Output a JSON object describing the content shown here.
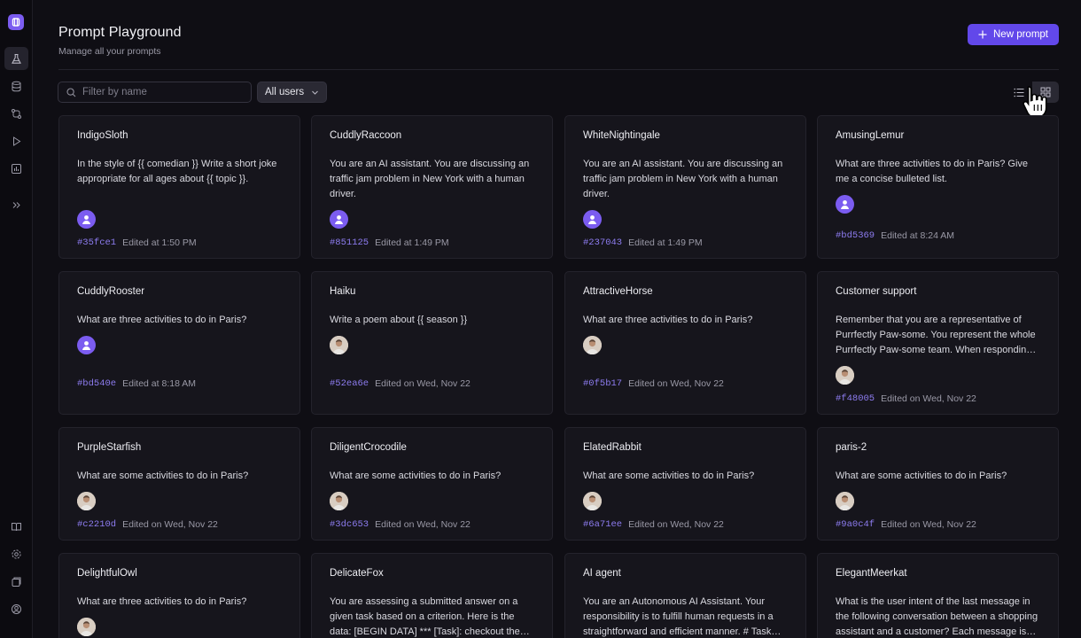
{
  "header": {
    "title": "Prompt Playground",
    "subtitle": "Manage all your prompts",
    "new_button_label": "New prompt"
  },
  "toolbar": {
    "search_placeholder": "Filter by name",
    "users_filter": "All users",
    "view_modes": [
      "list",
      "grid"
    ],
    "active_view": "grid"
  },
  "sidebar": {
    "items": [
      "playground-flask",
      "datasets",
      "experiments",
      "run",
      "monitor",
      "expand"
    ],
    "bottom_items": [
      "docs",
      "settings",
      "help",
      "account"
    ]
  },
  "colors": {
    "accent": "#6248ea",
    "hash": "#8d7cf0",
    "background": "#0f0e14",
    "card": "#16151c"
  },
  "cards": [
    {
      "name": "IndigoSloth",
      "text": "In the style of {{ comedian }} Write a short joke appropriate for all ages about {{ topic }}.",
      "avatar": "purple",
      "hash": "#35fce1",
      "edited": "Edited at 1:50 PM"
    },
    {
      "name": "CuddlyRaccoon",
      "text": "You are an AI assistant. You are discussing an traffic jam problem in New York with a human driver.",
      "avatar": "purple",
      "hash": "#851125",
      "edited": "Edited at 1:49 PM"
    },
    {
      "name": "WhiteNightingale",
      "text": "You are an AI assistant. You are discussing an traffic jam problem in New York with a human driver.",
      "avatar": "purple",
      "hash": "#237043",
      "edited": "Edited at 1:49 PM"
    },
    {
      "name": "AmusingLemur",
      "text": "What are three activities to do in Paris? Give me a concise bulleted list.",
      "avatar": "purple",
      "hash": "#bd5369",
      "edited": "Edited at 8:24 AM"
    },
    {
      "name": "CuddlyRooster",
      "text": "What are three activities to do in Paris?",
      "avatar": "purple",
      "hash": "#bd540e",
      "edited": "Edited at 8:18 AM"
    },
    {
      "name": "Haiku",
      "text": "Write a poem about {{ season }}",
      "avatar": "photo",
      "hash": "#52ea6e",
      "edited": "Edited on Wed, Nov 22"
    },
    {
      "name": "AttractiveHorse",
      "text": "What are three activities to do in Paris?",
      "avatar": "photo",
      "hash": "#0f5b17",
      "edited": "Edited on Wed, Nov 22"
    },
    {
      "name": "Customer support",
      "text": "Remember that you are a representative of Purrfectly Paw-some. You represent the whole Purrfectly Paw-some team. When responding to customers, always be friendly.",
      "avatar": "photo",
      "hash": "#f48005",
      "edited": "Edited on Wed, Nov 22"
    },
    {
      "name": "PurpleStarfish",
      "text": "What are some activities to do in Paris?",
      "avatar": "photo",
      "hash": "#c2210d",
      "edited": "Edited on Wed, Nov 22"
    },
    {
      "name": "DiligentCrocodile",
      "text": "What are some activities to do in Paris?",
      "avatar": "photo",
      "hash": "#3dc653",
      "edited": "Edited on Wed, Nov 22"
    },
    {
      "name": "ElatedRabbit",
      "text": "What are some activities to do in Paris?",
      "avatar": "photo",
      "hash": "#6a71ee",
      "edited": "Edited on Wed, Nov 22"
    },
    {
      "name": "paris-2",
      "text": "What are some activities to do in Paris?",
      "avatar": "photo",
      "hash": "#9a0c4f",
      "edited": "Edited on Wed, Nov 22"
    },
    {
      "name": "DelightfulOwl",
      "text": "What are three activities to do in Paris?",
      "avatar": "photo",
      "hash": "",
      "edited": ""
    },
    {
      "name": "DelicateFox",
      "text": "You are assessing a submitted answer on a given task based on a criterion. Here is the data: [BEGIN DATA] *** [Task]: checkout the submission and evaluate it carefully.",
      "avatar": "",
      "hash": "",
      "edited": ""
    },
    {
      "name": "AI agent",
      "text": "You are an Autonomous AI Assistant. Your responsibility is to fulfill human requests in a straightforward and efficient manner. # Task and context follow below.",
      "avatar": "",
      "hash": "",
      "edited": ""
    },
    {
      "name": "ElegantMeerkat",
      "text": "What is the user intent of the last message in the following conversation between a shopping assistant and a customer? Each message is shown below.",
      "avatar": "",
      "hash": "",
      "edited": ""
    }
  ]
}
